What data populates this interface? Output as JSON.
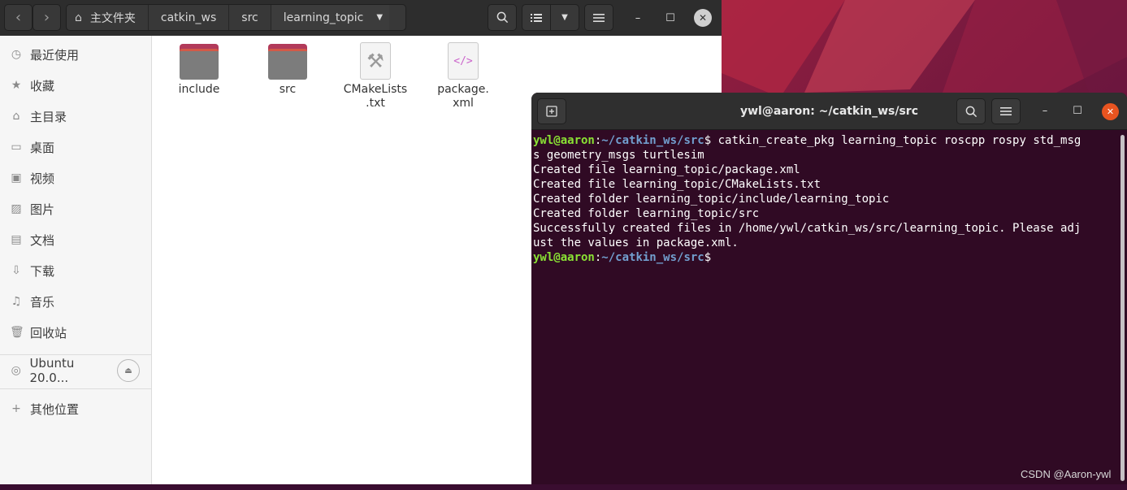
{
  "file_manager": {
    "breadcrumbs": [
      "主文件夹",
      "catkin_ws",
      "src",
      "learning_topic"
    ],
    "sidebar": {
      "items": [
        {
          "label": "最近使用",
          "icon": "clock-icon"
        },
        {
          "label": "收藏",
          "icon": "star-icon"
        },
        {
          "label": "主目录",
          "icon": "home-icon"
        },
        {
          "label": "桌面",
          "icon": "desktop-icon"
        },
        {
          "label": "视频",
          "icon": "video-icon"
        },
        {
          "label": "图片",
          "icon": "picture-icon"
        },
        {
          "label": "文档",
          "icon": "document-icon"
        },
        {
          "label": "下载",
          "icon": "download-icon"
        },
        {
          "label": "音乐",
          "icon": "music-icon"
        },
        {
          "label": "回收站",
          "icon": "trash-icon"
        }
      ],
      "device": "Ubuntu 20.0...",
      "other": "其他位置"
    },
    "files": [
      {
        "name": "include",
        "type": "folder"
      },
      {
        "name": "src",
        "type": "folder"
      },
      {
        "name": "CMakeLists\n.txt",
        "type": "cmake"
      },
      {
        "name": "package.\nxml",
        "type": "xml"
      }
    ]
  },
  "terminal": {
    "title": "ywl@aaron: ~/catkin_ws/src",
    "prompt_user": "ywl@aaron",
    "prompt_path": "~/catkin_ws/src",
    "lines": [
      "$ catkin_create_pkg learning_topic roscpp rospy std_msg",
      "s geometry_msgs turtlesim",
      "Created file learning_topic/package.xml",
      "Created file learning_topic/CMakeLists.txt",
      "Created folder learning_topic/include/learning_topic",
      "Created folder learning_topic/src",
      "Successfully created files in /home/ywl/catkin_ws/src/learning_topic. Please adj",
      "ust the values in package.xml."
    ],
    "prompt_end": "$"
  },
  "watermark": "CSDN @Aaron-ywl",
  "colors": {
    "terminal_bg": "#300a24",
    "prompt_user": "#8ae234",
    "prompt_path": "#729fcf",
    "accent": "#e95420"
  }
}
